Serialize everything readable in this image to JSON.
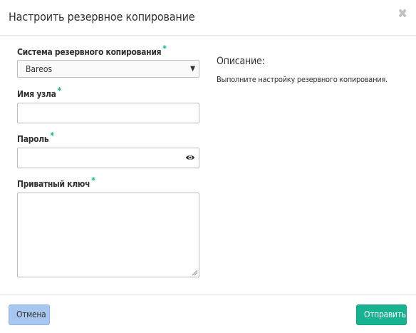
{
  "dialog": {
    "title": "Настроить резервное копирование",
    "close_icon": "close-icon"
  },
  "form": {
    "backup_system": {
      "label": "Система резервного копирования",
      "required_mark": "*",
      "selected": "Bareos",
      "arrow": "▼"
    },
    "hostname": {
      "label": "Имя узла",
      "required_mark": "*",
      "value": ""
    },
    "password": {
      "label": "Пароль",
      "required_mark": "*",
      "value": "",
      "toggle_icon": "eye-icon"
    },
    "private_key": {
      "label": "Приватный ключ",
      "required_mark": "*",
      "value": ""
    }
  },
  "description": {
    "title": "Описание:",
    "text": "Выполните настройку резервного копирования."
  },
  "footer": {
    "cancel_label": "Отмена",
    "submit_label": "Отправить"
  },
  "colors": {
    "accent": "#17b390",
    "cancel_bg": "#a8c7f0"
  }
}
